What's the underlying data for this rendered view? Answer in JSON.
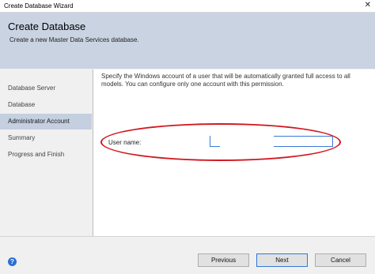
{
  "window": {
    "title": "Create Database Wizard",
    "close_glyph": "✕"
  },
  "header": {
    "title": "Create Database",
    "subtitle": "Create a new Master Data Services database."
  },
  "sidebar": {
    "items": [
      {
        "label": "Database Server",
        "active": false
      },
      {
        "label": "Database",
        "active": false
      },
      {
        "label": "Administrator Account",
        "active": true
      },
      {
        "label": "Summary",
        "active": false
      },
      {
        "label": "Progress and Finish",
        "active": false
      }
    ]
  },
  "main": {
    "description": "Specify the Windows account of a user that will be automatically granted full access to all models. You can configure only one account with this permission.",
    "user_name_label": "User name:",
    "user_name_value": ""
  },
  "footer": {
    "help_icon": "?",
    "previous_label": "Previous",
    "next_label": "Next",
    "cancel_label": "Cancel"
  },
  "colors": {
    "header_bg": "#c9d3e2",
    "selected_item_bg": "#c4cfe0",
    "annotation_red": "#d11820",
    "focus_blue": "#3178d4"
  }
}
